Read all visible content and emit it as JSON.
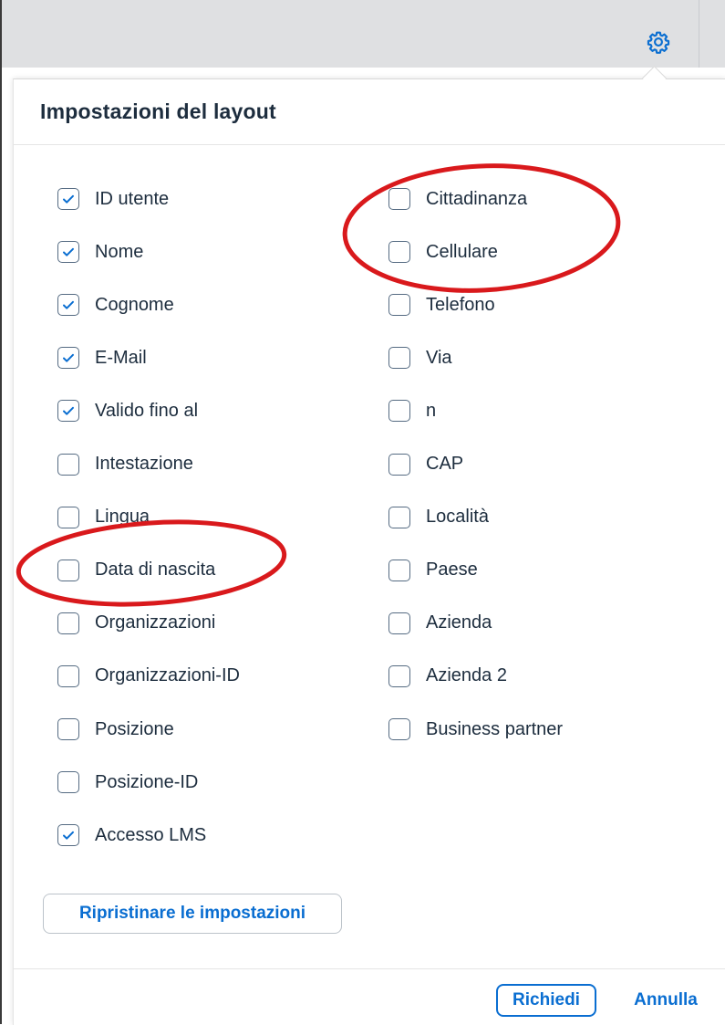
{
  "toolbar": {
    "settings_icon": "gear-icon"
  },
  "dialog": {
    "title": "Impostazioni del layout",
    "reset_label": "Ripristinare le impostazioni",
    "apply_label": "Richiedi",
    "cancel_label": "Annulla"
  },
  "columns": {
    "left": [
      {
        "label": "ID utente",
        "checked": true
      },
      {
        "label": "Nome",
        "checked": true
      },
      {
        "label": "Cognome",
        "checked": true
      },
      {
        "label": "E-Mail",
        "checked": true
      },
      {
        "label": "Valido fino al",
        "checked": true
      },
      {
        "label": "Intestazione",
        "checked": false
      },
      {
        "label": "Lingua",
        "checked": false
      },
      {
        "label": "Data di nascita",
        "checked": false
      },
      {
        "label": "Organizzazioni",
        "checked": false
      },
      {
        "label": "Organizzazioni-ID",
        "checked": false
      },
      {
        "label": "Posizione",
        "checked": false
      },
      {
        "label": "Posizione-ID",
        "checked": false
      },
      {
        "label": "Accesso LMS",
        "checked": true
      }
    ],
    "right": [
      {
        "label": "Cittadinanza",
        "checked": false
      },
      {
        "label": "Cellulare",
        "checked": false
      },
      {
        "label": "Telefono",
        "checked": false
      },
      {
        "label": "Via",
        "checked": false
      },
      {
        "label": "n",
        "checked": false
      },
      {
        "label": "CAP",
        "checked": false
      },
      {
        "label": "Località",
        "checked": false
      },
      {
        "label": "Paese",
        "checked": false
      },
      {
        "label": "Azienda",
        "checked": false
      },
      {
        "label": "Azienda 2",
        "checked": false
      },
      {
        "label": "Business partner",
        "checked": false
      }
    ]
  },
  "colors": {
    "accent": "#0a6ed1",
    "text": "#1d2d3e",
    "checkbox_border": "#556b82",
    "annotation": "#d9191c"
  }
}
